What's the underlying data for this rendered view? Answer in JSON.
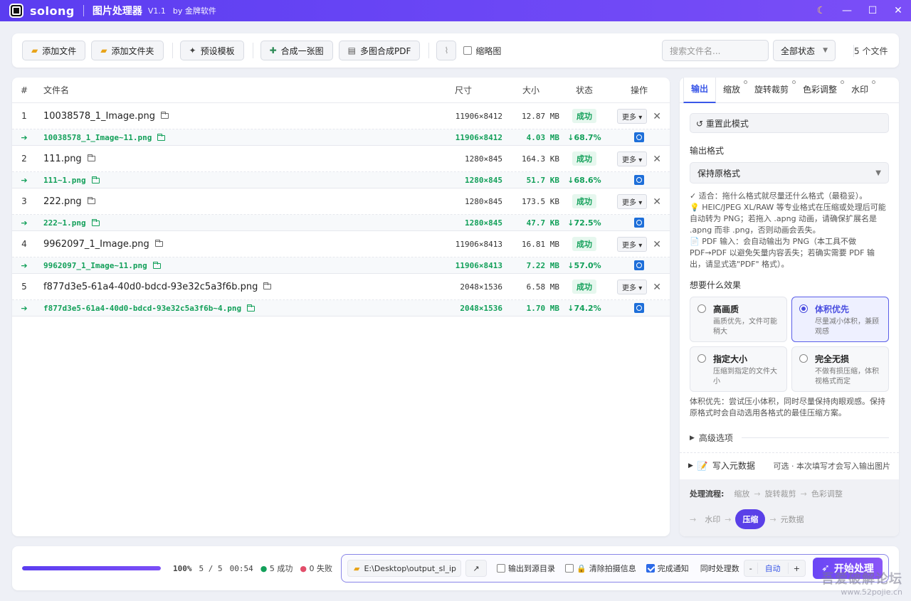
{
  "titlebar": {
    "app_name": "solong",
    "title": "图片处理器",
    "version": "V1.1",
    "by": "by 金牌软件",
    "theme_icon": "☾",
    "minimize": "—",
    "maximize": "☐",
    "close": "✕"
  },
  "toolbar": {
    "add_file": "添加文件",
    "add_folder": "添加文件夹",
    "preset": "预设模板",
    "merge_one": "合成一张图",
    "merge_pdf": "多图合成PDF",
    "thumbnail": "缩略图",
    "search_placeholder": "搜索文件名...",
    "status_filter": "全部状态",
    "file_count": "5  个文件"
  },
  "table": {
    "headers": {
      "idx": "#",
      "name": "文件名",
      "dim": "尺寸",
      "size": "大小",
      "status": "状态",
      "op": "操作"
    },
    "status_label": "成功",
    "more_label": "更多 ▾",
    "rows": [
      {
        "idx": "1",
        "name": "10038578_1_Image.png",
        "dim": "11906×8412",
        "size": "12.87 MB",
        "out_name": "10038578_1_Image~11.png",
        "out_dim": "11906×8412",
        "out_size": "4.03 MB",
        "ratio": "↓68.7%"
      },
      {
        "idx": "2",
        "name": "111.png",
        "dim": "1280×845",
        "size": "164.3 KB",
        "out_name": "111~1.png",
        "out_dim": "1280×845",
        "out_size": "51.7 KB",
        "ratio": "↓68.6%"
      },
      {
        "idx": "3",
        "name": "222.png",
        "dim": "1280×845",
        "size": "173.5 KB",
        "out_name": "222~1.png",
        "out_dim": "1280×845",
        "out_size": "47.7 KB",
        "ratio": "↓72.5%"
      },
      {
        "idx": "4",
        "name": "9962097_1_Image.png",
        "dim": "11906×8413",
        "size": "16.81 MB",
        "out_name": "9962097_1_Image~11.png",
        "out_dim": "11906×8413",
        "out_size": "7.22 MB",
        "ratio": "↓57.0%"
      },
      {
        "idx": "5",
        "name": "f877d3e5-61a4-40d0-bdcd-93e32c5a3f6b.png",
        "dim": "2048×1536",
        "size": "6.58 MB",
        "out_name": "f877d3e5-61a4-40d0-bdcd-93e32c5a3f6b~4.png",
        "out_dim": "2048×1536",
        "out_size": "1.70 MB",
        "ratio": "↓74.2%"
      }
    ]
  },
  "panel": {
    "tabs": [
      "输出",
      "缩放",
      "旋转裁剪",
      "色彩调整",
      "水印"
    ],
    "reset": "↺ 重置此模式",
    "output_format_label": "输出格式",
    "output_format": "保持原格式",
    "hint1": "✓ 适合：拖什么格式就尽量还什么格式（最稳妥）。",
    "hint2": "💡 HEIC/JPEG XL/RAW 等专业格式在压缩或处理后可能自动转为 PNG；若拖入 .apng 动画，请确保扩展名是 .apng 而非 .png，否则动画会丢失。",
    "hint3": "📄 PDF 输入：会自动输出为 PNG（本工具不做 PDF→PDF 以避免矢量内容丢失；若确实需要 PDF 输出，请显式选\"PDF\" 格式）。",
    "effect_label": "想要什么效果",
    "options": [
      {
        "title": "高画质",
        "desc": "画质优先，文件可能稍大"
      },
      {
        "title": "体积优先",
        "desc": "尽量减小体积，兼顾观感"
      },
      {
        "title": "指定大小",
        "desc": "压缩到指定的文件大小"
      },
      {
        "title": "完全无损",
        "desc": "不做有损压缩，体积视格式而定"
      }
    ],
    "selected_desc": "体积优先：尝试压小体积，同时尽量保持肉眼观感。保持原格式时会自动选用各格式的最佳压缩方案。",
    "advanced": "高级选项",
    "metadata": "写入元数据",
    "metadata_note": "可选 · 本次填写才会写入输出图片",
    "flow_label": "处理流程:",
    "flow_steps": [
      "缩放",
      "旋转裁剪",
      "色彩调整",
      "水印",
      "压缩",
      "元数据"
    ]
  },
  "bottom": {
    "progress_pct": 100,
    "progress_label": "100%",
    "count": "5 / 5",
    "time": "00:54",
    "success": "5 成功",
    "fail": "0 失败",
    "output_path": "E:\\Desktop\\output_sl_ip",
    "to_source": "输出到源目录",
    "clear_exif": "清除拍摄信息",
    "notify": "完成通知",
    "concurrency_label": "同时处理数",
    "concurrency": "自动",
    "start": "开始处理"
  },
  "watermark": {
    "line1": "吾爱破解论坛",
    "line2": "www.52pojie.cn"
  }
}
